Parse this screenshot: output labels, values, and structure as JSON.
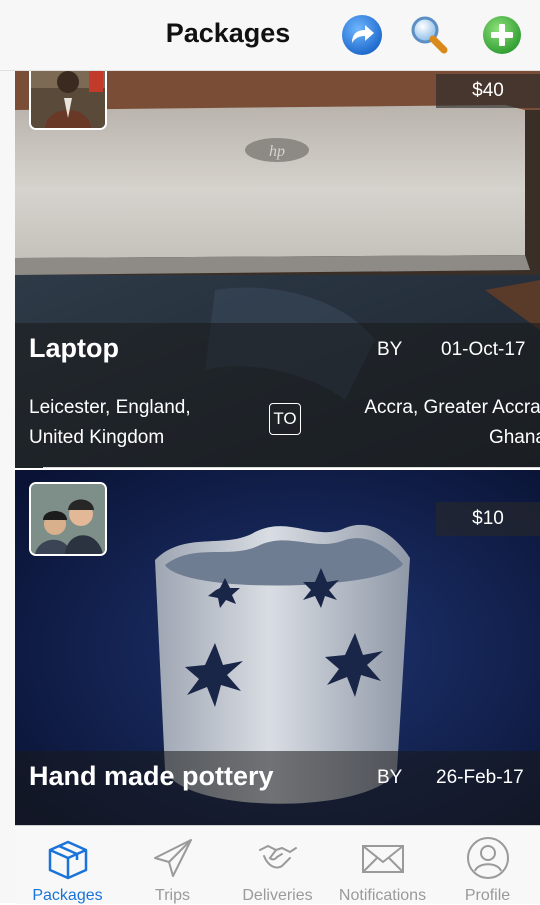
{
  "nav": {
    "title": "Packages",
    "icons": [
      "share-arrow-icon",
      "magnifier-icon",
      "add-plus-icon"
    ]
  },
  "colors": {
    "accent_blue": "#1a73d9",
    "add_green": "#39b54a",
    "tab_inactive": "#9a9a9a"
  },
  "packages": [
    {
      "title": "Laptop",
      "price": "$40",
      "by_label": "BY",
      "date": "01-Oct-17",
      "from": "Leicester, England, United Kingdom",
      "to_label": "TO",
      "to": [
        "Accra, Greater Accra,",
        "Ghana"
      ]
    },
    {
      "title": "Hand made pottery",
      "price": "$10",
      "by_label": "BY",
      "date": "26-Feb-17"
    }
  ],
  "tabs": [
    {
      "label": "Packages",
      "icon": "package-box-icon",
      "active": true
    },
    {
      "label": "Trips",
      "icon": "paper-plane-icon",
      "active": false
    },
    {
      "label": "Deliveries",
      "icon": "handshake-icon",
      "active": false
    },
    {
      "label": "Notifications",
      "icon": "envelope-icon",
      "active": false
    },
    {
      "label": "Profile",
      "icon": "person-icon",
      "active": false
    }
  ]
}
